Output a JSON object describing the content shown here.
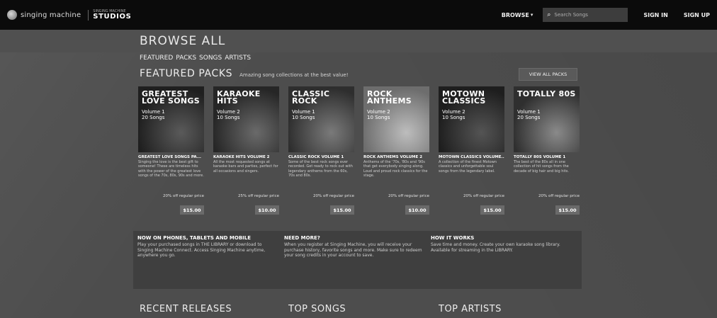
{
  "nav": {
    "logo_text": "singing machine",
    "badge_small": "SINGING MACHINE",
    "badge_big": "STUDIOS",
    "browse_label": "BROWSE",
    "search_placeholder": "Search Songs",
    "signin_label": "SIGN IN",
    "signup_label": "SIGN UP"
  },
  "page": {
    "title": "BROWSE ALL"
  },
  "tabs": [
    "FEATURED",
    "PACKS",
    "SONGS",
    "ARTISTS"
  ],
  "featured": {
    "title": "FEATURED PACKS",
    "subtitle": "Amazing song collections at the best value!",
    "view_all_label": "VIEW ALL PACKS"
  },
  "packs": [
    {
      "cover_title": "GREATEST LOVE SONGS",
      "cover_volume": "Volume 1",
      "cover_count": "20 Songs",
      "name": "GREATEST LOVE SONGS PA...",
      "desc": "Singing the love is the best gift to someone! These are timeless hits with the power of the greatest love songs of the 70s, 80s, 90s and more.",
      "more": "20% off regular price",
      "price": "$15.00",
      "art": [
        "#5a5a5a",
        "#1f1f1f"
      ]
    },
    {
      "cover_title": "KARAOKE HITS",
      "cover_volume": "Volume 2",
      "cover_count": "10 Songs",
      "name": "KARAOKE HITS VOLUME 2",
      "desc": "All the most requested songs at karaoke bars and parties, perfect for all occasions and singers.",
      "more": "25% off regular price",
      "price": "$10.00",
      "art": [
        "#6a6a6a",
        "#262626"
      ]
    },
    {
      "cover_title": "CLASSIC ROCK",
      "cover_volume": "Volume 1",
      "cover_count": "10 Songs",
      "name": "CLASSIC ROCK VOLUME 1",
      "desc": "Some of the best rock songs ever recorded. Get ready to rock out with legendary anthems from the 60s, 70s and 80s.",
      "more": "20% off regular price",
      "price": "$15.00",
      "art": [
        "#7a7a7a",
        "#2e2e2e"
      ]
    },
    {
      "cover_title": "ROCK ANTHEMS",
      "cover_volume": "Volume 2",
      "cover_count": "10 Songs",
      "name": "ROCK ANTHEMS VOLUME 2",
      "desc": "Anthems of the '70s, '80s and '90s that get everybody singing along. Loud and proud rock classics for the stage.",
      "more": "20% off regular price",
      "price": "$10.00",
      "art": [
        "#bdbdbd",
        "#6d6d6d"
      ]
    },
    {
      "cover_title": "MOTOWN CLASSICS",
      "cover_volume": "Volume 2",
      "cover_count": "10 Songs",
      "name": "MOTOWN CLASSICS VOLUME...",
      "desc": "A collection of the finest Motown classics and unforgettable soul songs from the legendary label.",
      "more": "20% off regular price",
      "price": "$15.00",
      "art": [
        "#545454",
        "#1e1e1e"
      ]
    },
    {
      "cover_title": "TOTALLY 80s",
      "cover_volume": "Volume 1",
      "cover_count": "20 Songs",
      "name": "TOTALLY 80S VOLUME 1",
      "desc": "The best of the 80s all in one collection of hit songs from the decade of big hair and big hits.",
      "more": "20% off regular price",
      "price": "$15.00",
      "art": [
        "#8a8a8a",
        "#2f2f2f"
      ]
    }
  ],
  "info": [
    {
      "title": "NOW ON PHONES, TABLETS AND MOBILE",
      "body": "Play your purchased songs in THE LIBRARY or download to Singing Machine Connect. Access Singing Machine anytime, anywhere you go."
    },
    {
      "title": "NEED MORE?",
      "body": "When you register at Singing Machine, you will receive your purchase history, favorite songs and more. Make sure to redeem your song credits in your account to save."
    },
    {
      "title": "HOW IT WORKS",
      "body": "Save time and money. Create your own karaoke song library. Available for streaming in the LIBRARY."
    }
  ],
  "bottom": {
    "recent": "RECENT RELEASES",
    "songs": "TOP SONGS",
    "artists": "TOP ARTISTS"
  }
}
